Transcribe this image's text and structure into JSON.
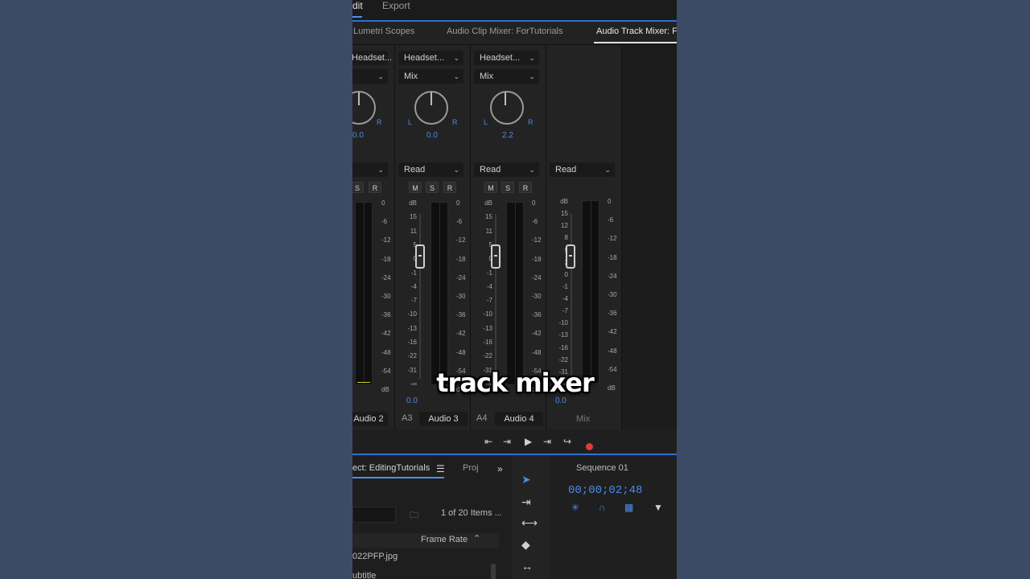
{
  "topbar": {
    "edit_label": "dit",
    "export_label": "Export"
  },
  "panel_tabs": [
    {
      "label": "Lumetri Scopes"
    },
    {
      "label": "Audio Clip Mixer: ForTutorials"
    },
    {
      "label": "Audio Track Mixer: F"
    }
  ],
  "channels": [
    {
      "output": "Headset...",
      "mode": "",
      "pan": "0.0",
      "auto": "",
      "level": "",
      "name": "Audio 2",
      "id": ""
    },
    {
      "output": "Headset...",
      "mode": "Mix",
      "pan": "0.0",
      "auto": "Read",
      "level": "0.0",
      "name": "Audio 3",
      "id": "A3"
    },
    {
      "output": "Headset...",
      "mode": "Mix",
      "pan": "2.2",
      "auto": "Read",
      "level": "",
      "name": "Audio 4",
      "id": "A4"
    },
    {
      "output": "",
      "mode": "",
      "pan": "",
      "auto": "Read",
      "level": "0.0",
      "name": "Mix",
      "id": ""
    }
  ],
  "buttons": {
    "m": "M",
    "s": "S",
    "r": "R"
  },
  "pan_labels": {
    "l": "L",
    "r": "R"
  },
  "fader_scale": [
    "dB",
    "15",
    "11",
    "5",
    "0",
    "-1",
    "-4",
    "-7",
    "-10",
    "-13",
    "-16",
    "-22",
    "-31",
    "-∞"
  ],
  "fader_scale_mix": [
    "dB",
    "15",
    "12",
    "8",
    "5",
    "2",
    "0",
    "-1",
    "-4",
    "-7",
    "-10",
    "-13",
    "-16",
    "-22",
    "-31",
    "-∞"
  ],
  "meter_scale": [
    "0",
    "-6",
    "-12",
    "-18",
    "-24",
    "-30",
    "-36",
    "-42",
    "-48",
    "-54",
    "dB"
  ],
  "project": {
    "tab_label": "ect: EditingTutorials",
    "tab2_label": "Proj",
    "items_count": "1 of 20 Items ...",
    "column": "Frame Rate",
    "rows": [
      "022PFP.jpg",
      "ubtitle"
    ]
  },
  "sequence": {
    "title": "Sequence 01",
    "timecode": "00;00;02;48"
  },
  "caption": "track mixer"
}
